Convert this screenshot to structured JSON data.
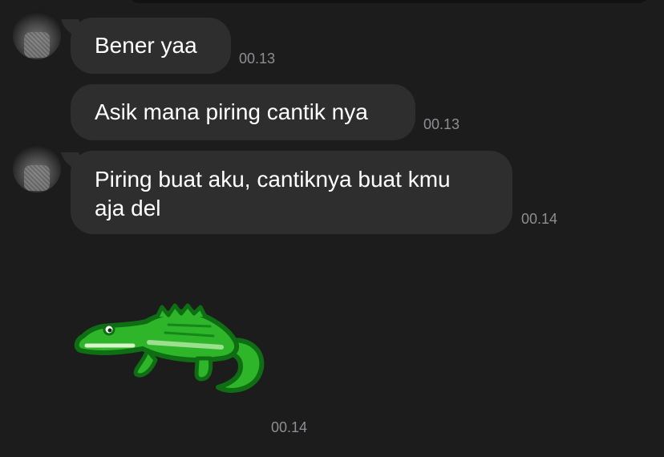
{
  "messages": [
    {
      "text": "Bener yaa",
      "time": "00.13",
      "has_avatar": true
    },
    {
      "text": "Asik mana piring cantik nya",
      "time": "00.13",
      "has_avatar": false
    },
    {
      "text": "Piring buat aku, cantiknya buat kmu aja del",
      "time": "00.14",
      "has_avatar": true
    },
    {
      "sticker": "crocodile-sticker",
      "time": "00.14"
    }
  ],
  "colors": {
    "background": "#1c1c1c",
    "bubble": "#2e2e2e",
    "text": "#ffffff",
    "timestamp": "#8e8e93",
    "croc_green": "#2fb52a",
    "croc_dark": "#14881a",
    "croc_outline": "#0f6d13"
  }
}
